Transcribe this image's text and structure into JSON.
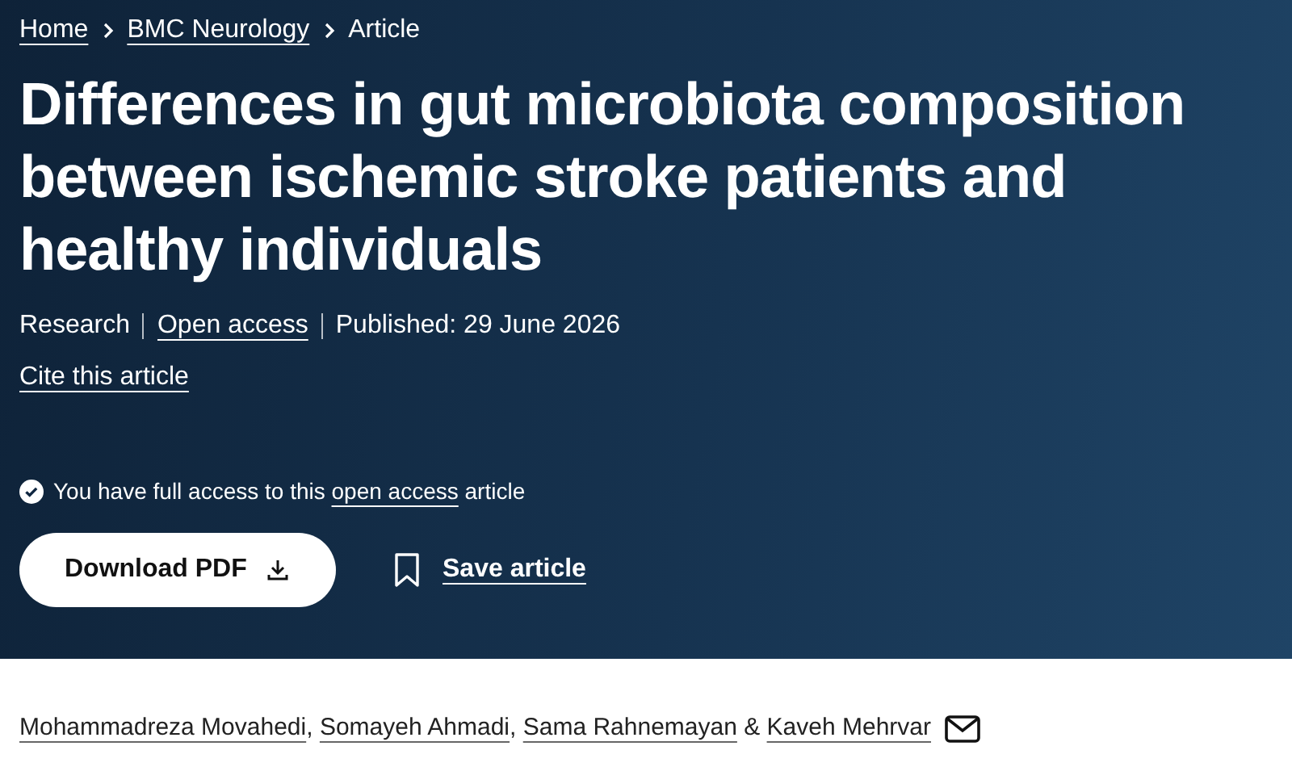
{
  "breadcrumbs": [
    {
      "label": "Home",
      "link": true
    },
    {
      "label": "BMC Neurology",
      "link": true
    },
    {
      "label": "Article",
      "link": false
    }
  ],
  "title": "Differences in gut microbiota composition between ischemic stroke patients and healthy individuals",
  "meta": [
    {
      "label": "Research",
      "link": false
    },
    {
      "label": "Open access",
      "link": true
    },
    {
      "label": "Published: 29 June 2026",
      "link": false
    }
  ],
  "cite_link": "Cite this article",
  "access_notice": {
    "before": "You have full access to this",
    "link": "open access",
    "after": "article"
  },
  "download_button": "Download PDF",
  "save_link": "Save article",
  "authors": [
    {
      "name": "Mohammadreza Movahedi",
      "separator": ","
    },
    {
      "name": "Somayeh Ahmadi",
      "separator": ","
    },
    {
      "name": "Sama Rahnemayan",
      "separator": "&"
    },
    {
      "name": "Kaveh Mehrvar"
    }
  ]
}
